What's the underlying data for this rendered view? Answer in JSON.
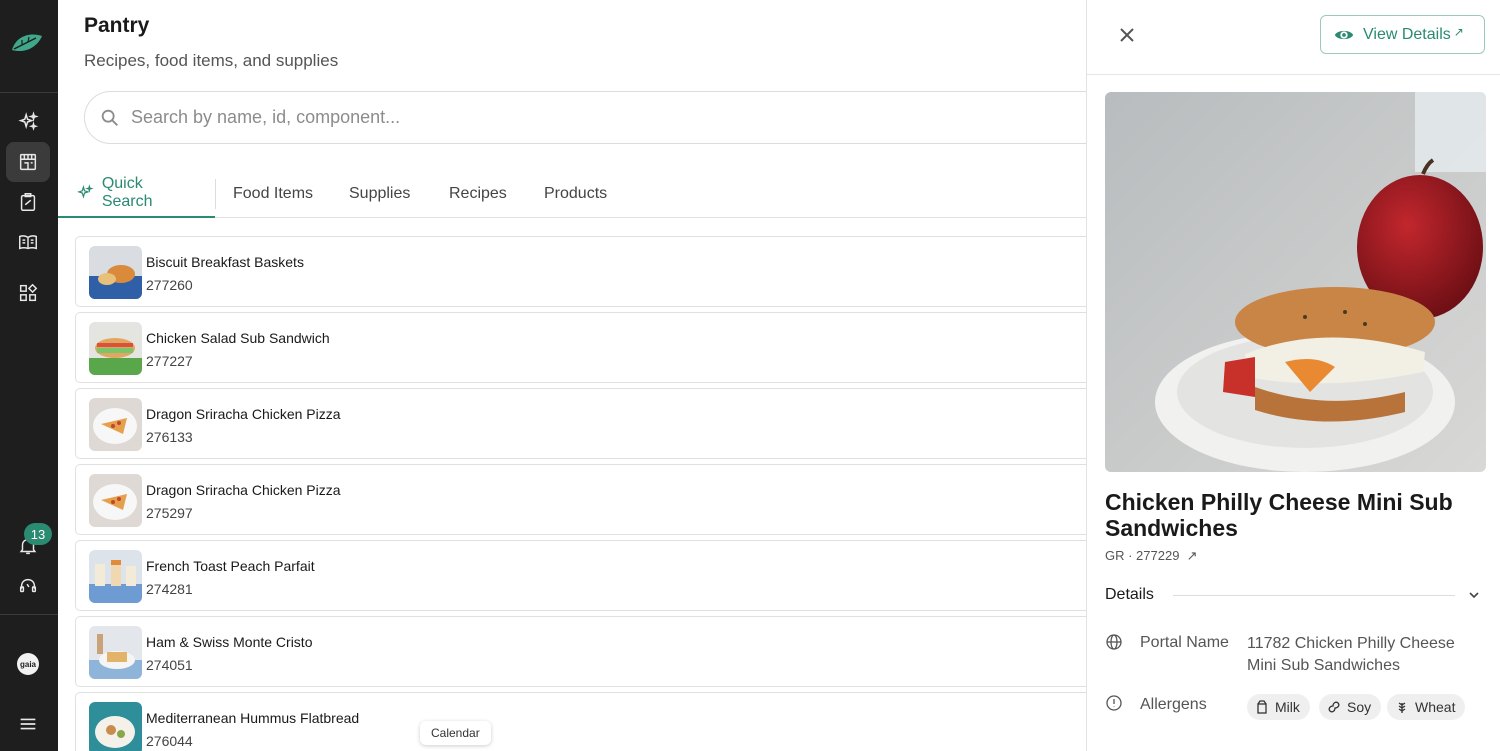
{
  "app": {
    "notification_count": "13",
    "org_badge": "gaia"
  },
  "header": {
    "title": "Pantry",
    "subtitle": "Recipes, food items, and supplies"
  },
  "search": {
    "placeholder": "Search by name, id, component..."
  },
  "tabs": [
    {
      "label": "Quick Search",
      "active": true
    },
    {
      "label": "Food Items"
    },
    {
      "label": "Supplies"
    },
    {
      "label": "Recipes"
    },
    {
      "label": "Products"
    }
  ],
  "items": [
    {
      "name": "Biscuit Breakfast Baskets",
      "id": "277260"
    },
    {
      "name": "Chicken Salad Sub Sandwich",
      "id": "277227"
    },
    {
      "name": "Dragon Sriracha Chicken Pizza",
      "id": "276133"
    },
    {
      "name": "Dragon Sriracha Chicken Pizza",
      "id": "275297"
    },
    {
      "name": "French Toast Peach Parfait",
      "id": "274281"
    },
    {
      "name": "Ham & Swiss Monte Cristo",
      "id": "274051"
    },
    {
      "name": "Mediterranean Hummus Flatbread",
      "id": "276044"
    }
  ],
  "tooltip": "Calendar",
  "panel": {
    "view_details": "View Details",
    "title": "Chicken Philly Cheese Mini Sub Sandwiches",
    "code": "GR · 277229",
    "details_label": "Details",
    "portal_name_label": "Portal Name",
    "portal_name_value": "11782 Chicken Philly Cheese Mini Sub Sandwiches",
    "allergens_label": "Allergens",
    "allergens": [
      "Milk",
      "Soy",
      "Wheat"
    ]
  },
  "colors": {
    "accent": "#2a8a72",
    "rail": "#1e1e1e"
  }
}
